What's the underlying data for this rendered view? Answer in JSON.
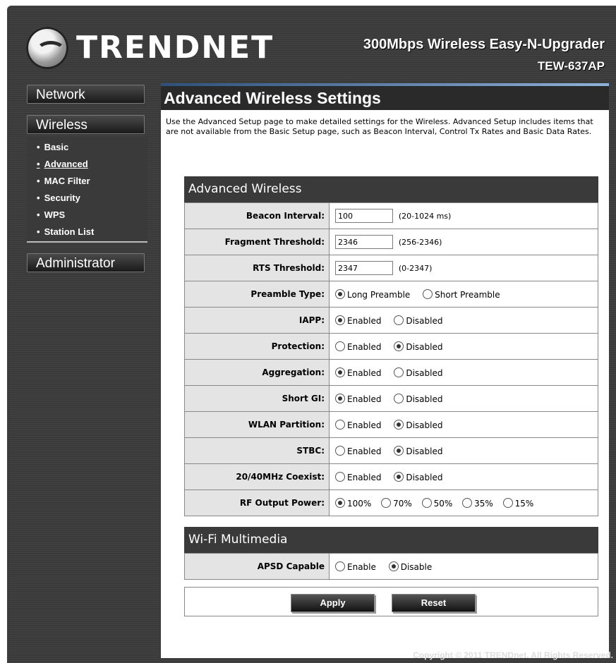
{
  "header": {
    "logo_text": "TRENDNET",
    "product_name": "300Mbps Wireless Easy-N-Upgrader",
    "model": "TEW-637AP"
  },
  "nav": {
    "network": "Network",
    "wireless": "Wireless",
    "administrator": "Administrator",
    "wireless_items": [
      "Basic",
      "Advanced",
      "MAC Filter",
      "Security",
      "WPS",
      "Station List"
    ],
    "active_item": "Advanced"
  },
  "page": {
    "title": "Advanced Wireless Settings",
    "description": "Use the Advanced Setup page to make detailed settings for the Wireless. Advanced Setup includes items that are not available from the Basic Setup page, such as Beacon Interval, Control Tx Rates and Basic Data Rates."
  },
  "advanced": {
    "section_title": "Advanced Wireless",
    "beacon_label": "Beacon Interval:",
    "beacon_value": "100",
    "beacon_hint": "(20-1024 ms)",
    "fragment_label": "Fragment Threshold:",
    "fragment_value": "2346",
    "fragment_hint": "(256-2346)",
    "rts_label": "RTS Threshold:",
    "rts_value": "2347",
    "rts_hint": "(0-2347)",
    "preamble_label": "Preamble Type:",
    "preamble_long": "Long Preamble",
    "preamble_short": "Short Preamble",
    "iapp_label": "IAPP:",
    "protection_label": "Protection:",
    "aggregation_label": "Aggregation:",
    "shortgi_label": "Short GI:",
    "wlan_partition_label": "WLAN Partition:",
    "stbc_label": "STBC:",
    "coexist_label": "20/40MHz Coexist:",
    "rf_label": "RF Output Power:",
    "enabled": "Enabled",
    "disabled": "Disabled",
    "rf_options": [
      "100%",
      "70%",
      "50%",
      "35%",
      "15%"
    ]
  },
  "wmm": {
    "section_title": "Wi-Fi Multimedia",
    "apsd_label": "APSD Capable",
    "enable": "Enable",
    "disable": "Disable"
  },
  "buttons": {
    "apply": "Apply",
    "reset": "Reset"
  },
  "footer": "Copyright © 2011 TRENDnet. All Rights Reserved."
}
